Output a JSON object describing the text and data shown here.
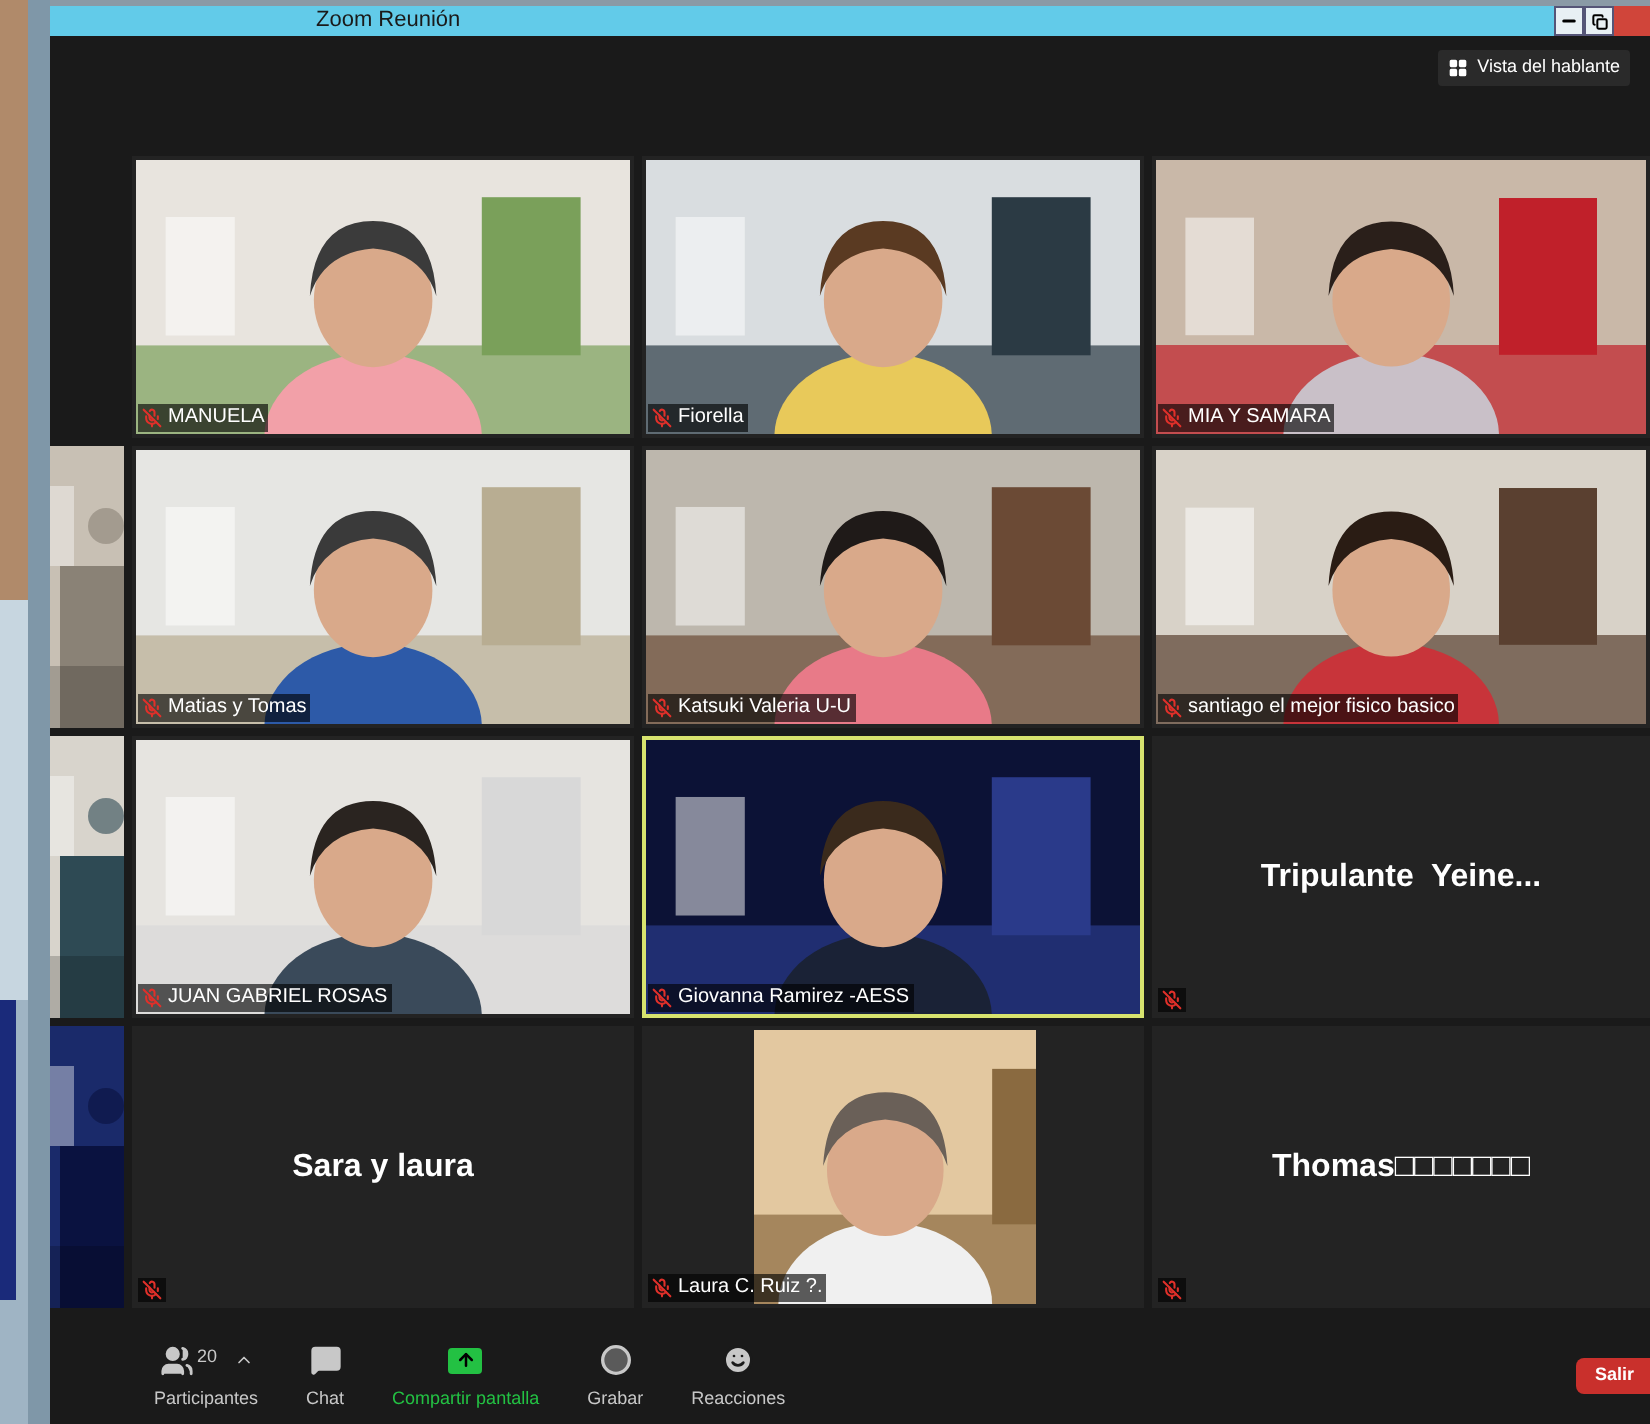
{
  "window": {
    "title": "Zoom Reunión"
  },
  "view_button": {
    "label": "Vista del hablante"
  },
  "tiles": [
    {
      "kind": "video",
      "name": "MANUELA",
      "muted": true,
      "speaking": false
    },
    {
      "kind": "video",
      "name": "Fiorella",
      "muted": true,
      "speaking": false
    },
    {
      "kind": "video",
      "name": "MIA Y SAMARA",
      "muted": true,
      "speaking": false
    },
    {
      "kind": "video",
      "name": "Matias y Tomas",
      "muted": true,
      "speaking": false
    },
    {
      "kind": "video",
      "name": "Katsuki Valeria U-U",
      "muted": true,
      "speaking": false
    },
    {
      "kind": "video",
      "name": "santiago el mejor fisico basico",
      "muted": true,
      "speaking": false
    },
    {
      "kind": "video",
      "name": "JUAN GABRIEL ROSAS",
      "muted": true,
      "speaking": false
    },
    {
      "kind": "video",
      "name": "Giovanna Ramirez -AESS",
      "muted": true,
      "speaking": true
    },
    {
      "kind": "name",
      "name": "Tripulante  Yeine...",
      "muted": true,
      "speaking": false
    },
    {
      "kind": "name",
      "name": "Sara y laura",
      "muted": true,
      "speaking": false
    },
    {
      "name": "Laura C. Ruiz ?.",
      "muted": true,
      "speaking": false
    },
    {
      "kind": "name",
      "name": "Thomas□□□□□□□",
      "muted": true,
      "speaking": false
    }
  ],
  "toolbar": {
    "items": [
      {
        "kind": "participants",
        "label": "Participantes",
        "count": "20"
      },
      {
        "kind": "chat",
        "label": "Chat"
      },
      {
        "kind": "share",
        "label": "Compartir pantalla"
      },
      {
        "kind": "record",
        "label": "Grabar"
      },
      {
        "kind": "reactions",
        "label": "Reacciones"
      }
    ],
    "leave_button": {
      "label": "Salir"
    }
  }
}
